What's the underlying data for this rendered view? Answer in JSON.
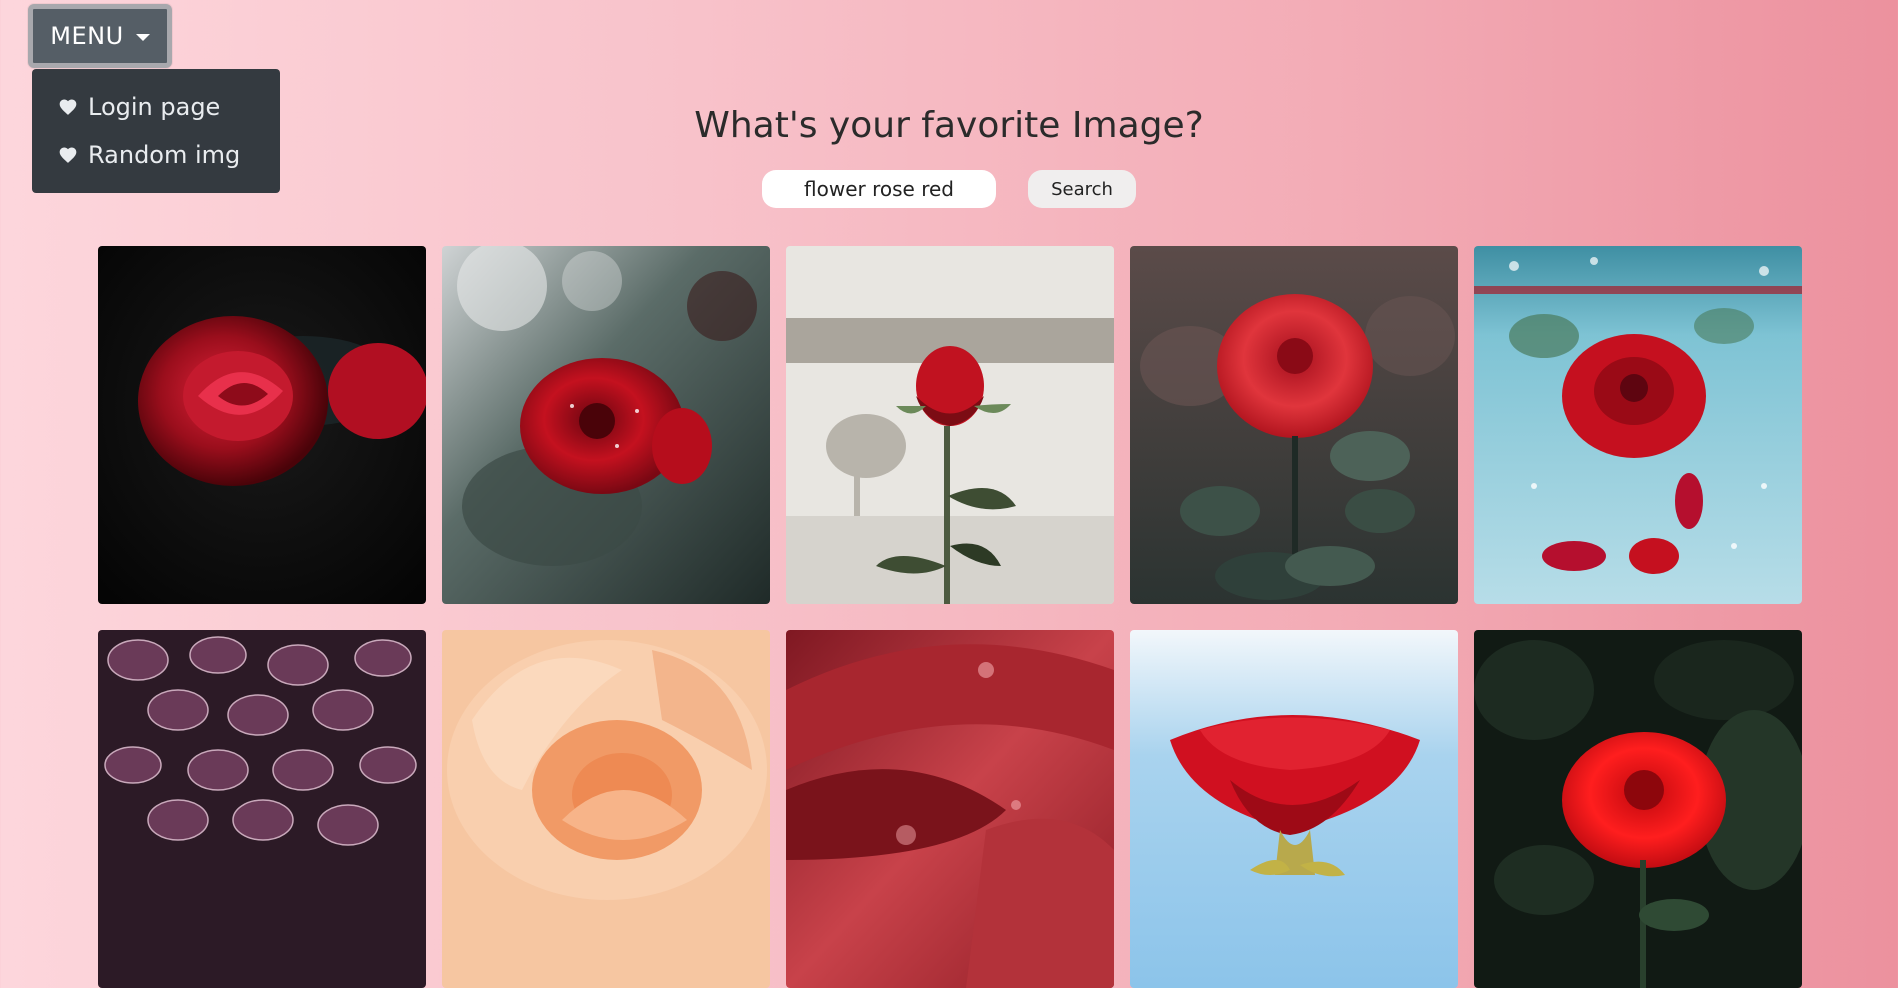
{
  "menu": {
    "label": "MENU",
    "items": [
      {
        "label": "Login page",
        "icon": "heart-icon"
      },
      {
        "label": "Random img",
        "icon": "heart-icon"
      }
    ]
  },
  "heading": "What's your favorite Image?",
  "search": {
    "value": "flower rose red",
    "button_label": "Search"
  },
  "gallery": {
    "images": [
      {
        "subject": "dark red rose on black background"
      },
      {
        "subject": "red rose with raindrops, blurred green background"
      },
      {
        "subject": "single red rose against white wall with shadow"
      },
      {
        "subject": "red rose with dewy dark leaves"
      },
      {
        "subject": "red rose underwater with bubbles and petals"
      },
      {
        "subject": "purple veined leaves pattern"
      },
      {
        "subject": "peach rose close-up"
      },
      {
        "subject": "red rose petals macro with droplets"
      },
      {
        "subject": "red rose against blue sky"
      },
      {
        "subject": "red rose on dark green foliage"
      }
    ]
  },
  "colors": {
    "menu_button": "#555e66",
    "dropdown": "#343a40",
    "background_start": "#fdd6dc",
    "background_end": "#ec919e"
  }
}
